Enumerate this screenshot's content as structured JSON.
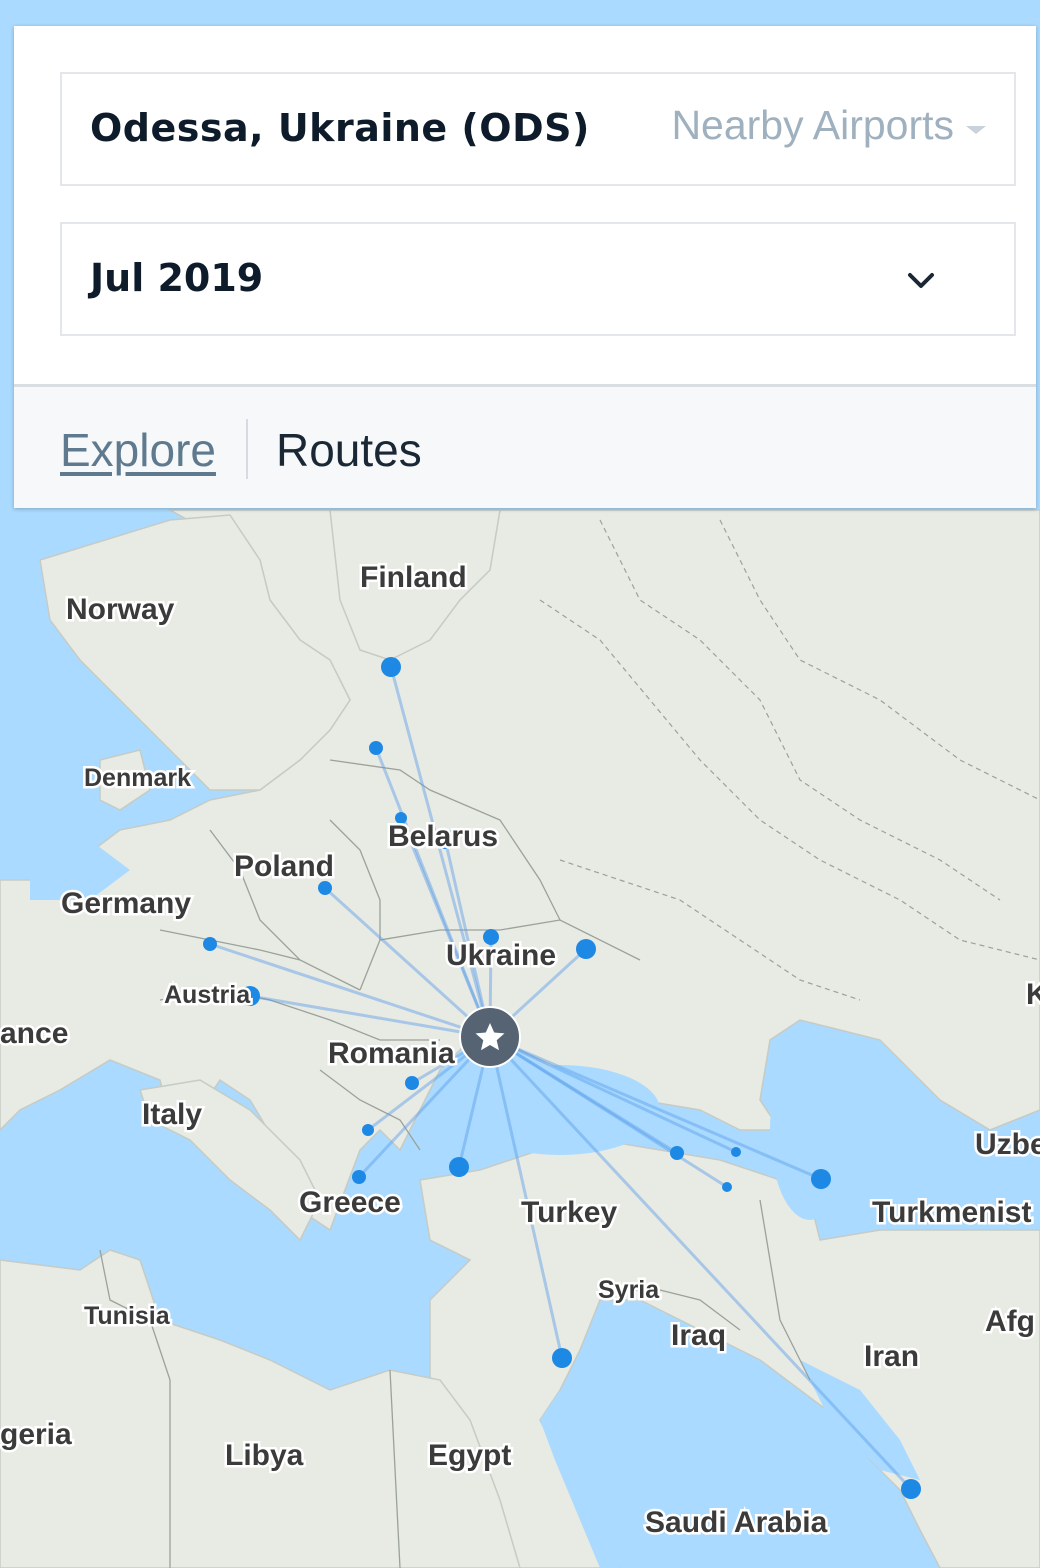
{
  "search": {
    "origin": "Odessa, Ukraine (ODS)",
    "nearby_label": "Nearby Airports",
    "month": "Jul 2019"
  },
  "tabs": {
    "explore": "Explore",
    "routes": "Routes"
  },
  "map": {
    "labels": {
      "finland": "Finland",
      "norway": "Norway",
      "denmark": "Denmark",
      "belarus": "Belarus",
      "poland": "Poland",
      "germany": "Germany",
      "ukraine": "Ukraine",
      "austria": "Austria",
      "france": "ance",
      "romania": "Romania",
      "italy": "Italy",
      "greece": "Greece",
      "turkey": "Turkey",
      "syria": "Syria",
      "iraq": "Iraq",
      "iran": "Iran",
      "tunisia": "Tunisia",
      "algeria": "geria",
      "libya": "Libya",
      "egypt": "Egypt",
      "saudi": "Saudi Arabia",
      "uzbek": "Uzbe",
      "turkmen": "Turkmenist",
      "afghan": "Afg",
      "kaz": "K"
    },
    "origin_icon": "star-icon",
    "colors": {
      "water": "#aadaff",
      "land": "#e8eae4",
      "route": "#5b9ee8",
      "dot": "#1e88e5",
      "origin": "#556372"
    }
  }
}
